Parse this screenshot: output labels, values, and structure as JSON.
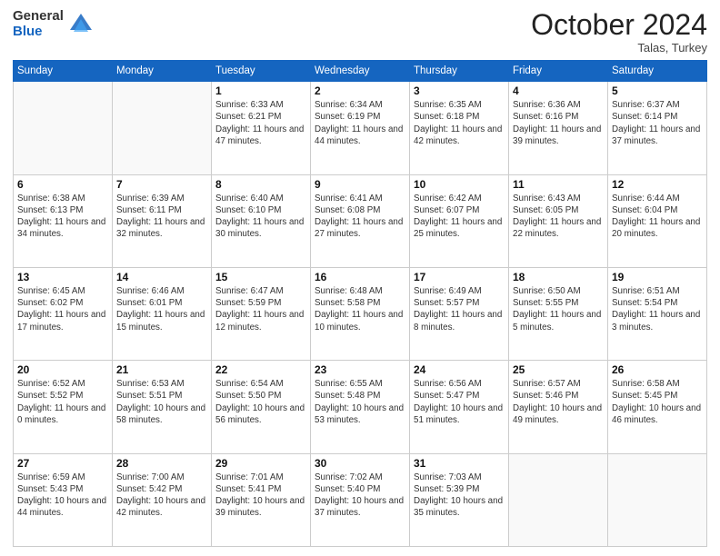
{
  "header": {
    "logo_general": "General",
    "logo_blue": "Blue",
    "month_title": "October 2024",
    "location": "Talas, Turkey"
  },
  "days_of_week": [
    "Sunday",
    "Monday",
    "Tuesday",
    "Wednesday",
    "Thursday",
    "Friday",
    "Saturday"
  ],
  "weeks": [
    [
      {
        "day": "",
        "sunrise": "",
        "sunset": "",
        "daylight": ""
      },
      {
        "day": "",
        "sunrise": "",
        "sunset": "",
        "daylight": ""
      },
      {
        "day": "1",
        "sunrise": "Sunrise: 6:33 AM",
        "sunset": "Sunset: 6:21 PM",
        "daylight": "Daylight: 11 hours and 47 minutes."
      },
      {
        "day": "2",
        "sunrise": "Sunrise: 6:34 AM",
        "sunset": "Sunset: 6:19 PM",
        "daylight": "Daylight: 11 hours and 44 minutes."
      },
      {
        "day": "3",
        "sunrise": "Sunrise: 6:35 AM",
        "sunset": "Sunset: 6:18 PM",
        "daylight": "Daylight: 11 hours and 42 minutes."
      },
      {
        "day": "4",
        "sunrise": "Sunrise: 6:36 AM",
        "sunset": "Sunset: 6:16 PM",
        "daylight": "Daylight: 11 hours and 39 minutes."
      },
      {
        "day": "5",
        "sunrise": "Sunrise: 6:37 AM",
        "sunset": "Sunset: 6:14 PM",
        "daylight": "Daylight: 11 hours and 37 minutes."
      }
    ],
    [
      {
        "day": "6",
        "sunrise": "Sunrise: 6:38 AM",
        "sunset": "Sunset: 6:13 PM",
        "daylight": "Daylight: 11 hours and 34 minutes."
      },
      {
        "day": "7",
        "sunrise": "Sunrise: 6:39 AM",
        "sunset": "Sunset: 6:11 PM",
        "daylight": "Daylight: 11 hours and 32 minutes."
      },
      {
        "day": "8",
        "sunrise": "Sunrise: 6:40 AM",
        "sunset": "Sunset: 6:10 PM",
        "daylight": "Daylight: 11 hours and 30 minutes."
      },
      {
        "day": "9",
        "sunrise": "Sunrise: 6:41 AM",
        "sunset": "Sunset: 6:08 PM",
        "daylight": "Daylight: 11 hours and 27 minutes."
      },
      {
        "day": "10",
        "sunrise": "Sunrise: 6:42 AM",
        "sunset": "Sunset: 6:07 PM",
        "daylight": "Daylight: 11 hours and 25 minutes."
      },
      {
        "day": "11",
        "sunrise": "Sunrise: 6:43 AM",
        "sunset": "Sunset: 6:05 PM",
        "daylight": "Daylight: 11 hours and 22 minutes."
      },
      {
        "day": "12",
        "sunrise": "Sunrise: 6:44 AM",
        "sunset": "Sunset: 6:04 PM",
        "daylight": "Daylight: 11 hours and 20 minutes."
      }
    ],
    [
      {
        "day": "13",
        "sunrise": "Sunrise: 6:45 AM",
        "sunset": "Sunset: 6:02 PM",
        "daylight": "Daylight: 11 hours and 17 minutes."
      },
      {
        "day": "14",
        "sunrise": "Sunrise: 6:46 AM",
        "sunset": "Sunset: 6:01 PM",
        "daylight": "Daylight: 11 hours and 15 minutes."
      },
      {
        "day": "15",
        "sunrise": "Sunrise: 6:47 AM",
        "sunset": "Sunset: 5:59 PM",
        "daylight": "Daylight: 11 hours and 12 minutes."
      },
      {
        "day": "16",
        "sunrise": "Sunrise: 6:48 AM",
        "sunset": "Sunset: 5:58 PM",
        "daylight": "Daylight: 11 hours and 10 minutes."
      },
      {
        "day": "17",
        "sunrise": "Sunrise: 6:49 AM",
        "sunset": "Sunset: 5:57 PM",
        "daylight": "Daylight: 11 hours and 8 minutes."
      },
      {
        "day": "18",
        "sunrise": "Sunrise: 6:50 AM",
        "sunset": "Sunset: 5:55 PM",
        "daylight": "Daylight: 11 hours and 5 minutes."
      },
      {
        "day": "19",
        "sunrise": "Sunrise: 6:51 AM",
        "sunset": "Sunset: 5:54 PM",
        "daylight": "Daylight: 11 hours and 3 minutes."
      }
    ],
    [
      {
        "day": "20",
        "sunrise": "Sunrise: 6:52 AM",
        "sunset": "Sunset: 5:52 PM",
        "daylight": "Daylight: 11 hours and 0 minutes."
      },
      {
        "day": "21",
        "sunrise": "Sunrise: 6:53 AM",
        "sunset": "Sunset: 5:51 PM",
        "daylight": "Daylight: 10 hours and 58 minutes."
      },
      {
        "day": "22",
        "sunrise": "Sunrise: 6:54 AM",
        "sunset": "Sunset: 5:50 PM",
        "daylight": "Daylight: 10 hours and 56 minutes."
      },
      {
        "day": "23",
        "sunrise": "Sunrise: 6:55 AM",
        "sunset": "Sunset: 5:48 PM",
        "daylight": "Daylight: 10 hours and 53 minutes."
      },
      {
        "day": "24",
        "sunrise": "Sunrise: 6:56 AM",
        "sunset": "Sunset: 5:47 PM",
        "daylight": "Daylight: 10 hours and 51 minutes."
      },
      {
        "day": "25",
        "sunrise": "Sunrise: 6:57 AM",
        "sunset": "Sunset: 5:46 PM",
        "daylight": "Daylight: 10 hours and 49 minutes."
      },
      {
        "day": "26",
        "sunrise": "Sunrise: 6:58 AM",
        "sunset": "Sunset: 5:45 PM",
        "daylight": "Daylight: 10 hours and 46 minutes."
      }
    ],
    [
      {
        "day": "27",
        "sunrise": "Sunrise: 6:59 AM",
        "sunset": "Sunset: 5:43 PM",
        "daylight": "Daylight: 10 hours and 44 minutes."
      },
      {
        "day": "28",
        "sunrise": "Sunrise: 7:00 AM",
        "sunset": "Sunset: 5:42 PM",
        "daylight": "Daylight: 10 hours and 42 minutes."
      },
      {
        "day": "29",
        "sunrise": "Sunrise: 7:01 AM",
        "sunset": "Sunset: 5:41 PM",
        "daylight": "Daylight: 10 hours and 39 minutes."
      },
      {
        "day": "30",
        "sunrise": "Sunrise: 7:02 AM",
        "sunset": "Sunset: 5:40 PM",
        "daylight": "Daylight: 10 hours and 37 minutes."
      },
      {
        "day": "31",
        "sunrise": "Sunrise: 7:03 AM",
        "sunset": "Sunset: 5:39 PM",
        "daylight": "Daylight: 10 hours and 35 minutes."
      },
      {
        "day": "",
        "sunrise": "",
        "sunset": "",
        "daylight": ""
      },
      {
        "day": "",
        "sunrise": "",
        "sunset": "",
        "daylight": ""
      }
    ]
  ]
}
